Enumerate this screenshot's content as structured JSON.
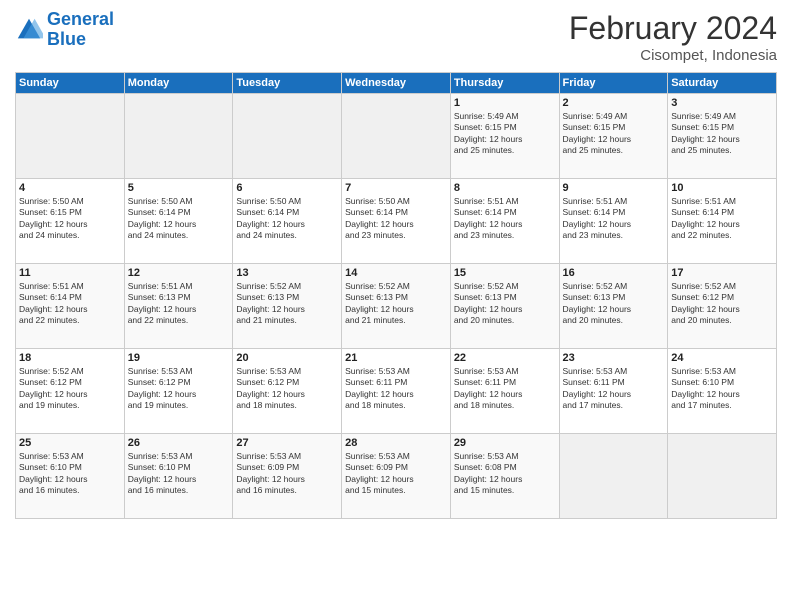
{
  "logo": {
    "line1": "General",
    "line2": "Blue"
  },
  "title": "February 2024",
  "subtitle": "Cisompet, Indonesia",
  "days_header": [
    "Sunday",
    "Monday",
    "Tuesday",
    "Wednesday",
    "Thursday",
    "Friday",
    "Saturday"
  ],
  "weeks": [
    [
      {
        "day": "",
        "info": ""
      },
      {
        "day": "",
        "info": ""
      },
      {
        "day": "",
        "info": ""
      },
      {
        "day": "",
        "info": ""
      },
      {
        "day": "1",
        "info": "Sunrise: 5:49 AM\nSunset: 6:15 PM\nDaylight: 12 hours\nand 25 minutes."
      },
      {
        "day": "2",
        "info": "Sunrise: 5:49 AM\nSunset: 6:15 PM\nDaylight: 12 hours\nand 25 minutes."
      },
      {
        "day": "3",
        "info": "Sunrise: 5:49 AM\nSunset: 6:15 PM\nDaylight: 12 hours\nand 25 minutes."
      }
    ],
    [
      {
        "day": "4",
        "info": "Sunrise: 5:50 AM\nSunset: 6:15 PM\nDaylight: 12 hours\nand 24 minutes."
      },
      {
        "day": "5",
        "info": "Sunrise: 5:50 AM\nSunset: 6:14 PM\nDaylight: 12 hours\nand 24 minutes."
      },
      {
        "day": "6",
        "info": "Sunrise: 5:50 AM\nSunset: 6:14 PM\nDaylight: 12 hours\nand 24 minutes."
      },
      {
        "day": "7",
        "info": "Sunrise: 5:50 AM\nSunset: 6:14 PM\nDaylight: 12 hours\nand 23 minutes."
      },
      {
        "day": "8",
        "info": "Sunrise: 5:51 AM\nSunset: 6:14 PM\nDaylight: 12 hours\nand 23 minutes."
      },
      {
        "day": "9",
        "info": "Sunrise: 5:51 AM\nSunset: 6:14 PM\nDaylight: 12 hours\nand 23 minutes."
      },
      {
        "day": "10",
        "info": "Sunrise: 5:51 AM\nSunset: 6:14 PM\nDaylight: 12 hours\nand 22 minutes."
      }
    ],
    [
      {
        "day": "11",
        "info": "Sunrise: 5:51 AM\nSunset: 6:14 PM\nDaylight: 12 hours\nand 22 minutes."
      },
      {
        "day": "12",
        "info": "Sunrise: 5:51 AM\nSunset: 6:13 PM\nDaylight: 12 hours\nand 22 minutes."
      },
      {
        "day": "13",
        "info": "Sunrise: 5:52 AM\nSunset: 6:13 PM\nDaylight: 12 hours\nand 21 minutes."
      },
      {
        "day": "14",
        "info": "Sunrise: 5:52 AM\nSunset: 6:13 PM\nDaylight: 12 hours\nand 21 minutes."
      },
      {
        "day": "15",
        "info": "Sunrise: 5:52 AM\nSunset: 6:13 PM\nDaylight: 12 hours\nand 20 minutes."
      },
      {
        "day": "16",
        "info": "Sunrise: 5:52 AM\nSunset: 6:13 PM\nDaylight: 12 hours\nand 20 minutes."
      },
      {
        "day": "17",
        "info": "Sunrise: 5:52 AM\nSunset: 6:12 PM\nDaylight: 12 hours\nand 20 minutes."
      }
    ],
    [
      {
        "day": "18",
        "info": "Sunrise: 5:52 AM\nSunset: 6:12 PM\nDaylight: 12 hours\nand 19 minutes."
      },
      {
        "day": "19",
        "info": "Sunrise: 5:53 AM\nSunset: 6:12 PM\nDaylight: 12 hours\nand 19 minutes."
      },
      {
        "day": "20",
        "info": "Sunrise: 5:53 AM\nSunset: 6:12 PM\nDaylight: 12 hours\nand 18 minutes."
      },
      {
        "day": "21",
        "info": "Sunrise: 5:53 AM\nSunset: 6:11 PM\nDaylight: 12 hours\nand 18 minutes."
      },
      {
        "day": "22",
        "info": "Sunrise: 5:53 AM\nSunset: 6:11 PM\nDaylight: 12 hours\nand 18 minutes."
      },
      {
        "day": "23",
        "info": "Sunrise: 5:53 AM\nSunset: 6:11 PM\nDaylight: 12 hours\nand 17 minutes."
      },
      {
        "day": "24",
        "info": "Sunrise: 5:53 AM\nSunset: 6:10 PM\nDaylight: 12 hours\nand 17 minutes."
      }
    ],
    [
      {
        "day": "25",
        "info": "Sunrise: 5:53 AM\nSunset: 6:10 PM\nDaylight: 12 hours\nand 16 minutes."
      },
      {
        "day": "26",
        "info": "Sunrise: 5:53 AM\nSunset: 6:10 PM\nDaylight: 12 hours\nand 16 minutes."
      },
      {
        "day": "27",
        "info": "Sunrise: 5:53 AM\nSunset: 6:09 PM\nDaylight: 12 hours\nand 16 minutes."
      },
      {
        "day": "28",
        "info": "Sunrise: 5:53 AM\nSunset: 6:09 PM\nDaylight: 12 hours\nand 15 minutes."
      },
      {
        "day": "29",
        "info": "Sunrise: 5:53 AM\nSunset: 6:08 PM\nDaylight: 12 hours\nand 15 minutes."
      },
      {
        "day": "",
        "info": ""
      },
      {
        "day": "",
        "info": ""
      }
    ]
  ]
}
